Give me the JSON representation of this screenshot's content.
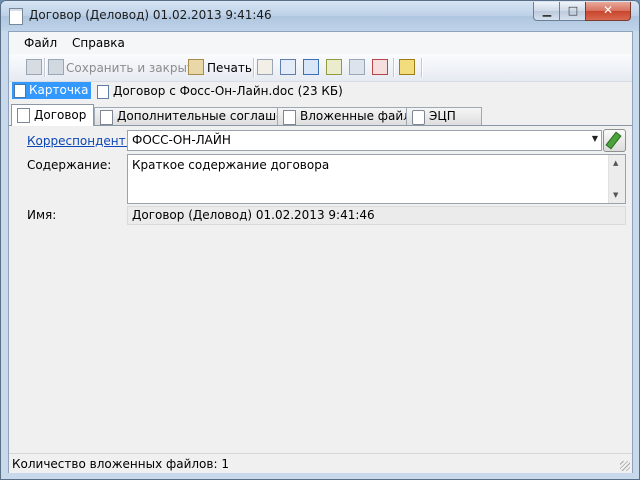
{
  "window": {
    "title": "Договор (Деловод) 01.02.2013 9:41:46",
    "controls": {
      "minimize": "▁",
      "maximize": "□",
      "close": "✕"
    }
  },
  "menu": {
    "items": [
      "Файл",
      "Справка"
    ]
  },
  "toolbar": {
    "save_close_label": "Сохранить и закрыть",
    "print_label": "Печать",
    "icons": [
      "save-icon",
      "save-close-icon",
      "print-icon",
      "edit-doc-icon",
      "check-doc-icon",
      "calendar-icon",
      "attach-icon",
      "archive-icon",
      "pdf-icon",
      "sign-icon"
    ]
  },
  "doc_bar": {
    "card_label": "Карточка",
    "file_label": "Договор с Фосс-Он-Лайн.doc (23 КБ)"
  },
  "tabs": [
    {
      "label": "Договор",
      "active": true
    },
    {
      "label": "Дополнительные соглашения",
      "active": false
    },
    {
      "label": "Вложенные файлы",
      "active": false
    },
    {
      "label": "ЭЦП",
      "active": false
    }
  ],
  "form": {
    "correspondent_label": "Корреспондент:",
    "correspondent_value": "ФОСС-ОН-ЛАЙН",
    "content_label": "Содержание:",
    "content_value": "Краткое содержание договора",
    "name_label": "Имя:",
    "name_value": "Договор (Деловод) 01.02.2013 9:41:46"
  },
  "status": {
    "text": "Количество вложенных файлов: 1"
  },
  "colors": {
    "selection": "#3399ff",
    "link": "#0d47b5",
    "titlebar": "#bcd0e7",
    "close_button": "#c8452c"
  }
}
